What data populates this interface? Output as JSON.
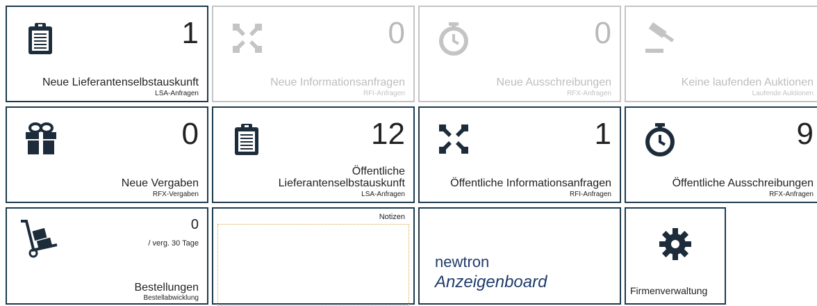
{
  "row1": [
    {
      "count": "1",
      "title": "Neue Lieferantenselbstauskunft",
      "sub": "LSA-Anfragen",
      "icon": "clipboard-icon"
    },
    {
      "count": "0",
      "title": "Neue Informationsanfragen",
      "sub": "RFI-Anfragen",
      "icon": "compress-icon"
    },
    {
      "count": "0",
      "title": "Neue Ausschreibungen",
      "sub": "RFX-Anfragen",
      "icon": "stopwatch-icon"
    },
    {
      "count": "",
      "title": "Keine laufenden Auktionen",
      "sub": "Laufende Auktionen",
      "icon": "gavel-icon"
    }
  ],
  "row2": [
    {
      "count": "0",
      "title": "Neue Vergaben",
      "sub": "RFX-Vergaben",
      "icon": "gift-icon"
    },
    {
      "count": "12",
      "title_line1": "Öffentliche",
      "title_line2": "Lieferantenselbstauskunft",
      "sub": "LSA-Anfragen",
      "icon": "clipboard-icon"
    },
    {
      "count": "1",
      "title": "Öffentliche Informationsanfragen",
      "sub": "RFI-Anfragen",
      "icon": "compress-icon"
    },
    {
      "count": "9",
      "title": "Öffentliche Ausschreibungen",
      "sub": "RFX-Anfragen",
      "icon": "stopwatch-icon"
    }
  ],
  "orders": {
    "count": "0",
    "period": "/ verg. 30 Tage",
    "title": "Bestellungen",
    "sub": "Bestellabwicklung",
    "icon": "hand-truck-icon"
  },
  "notes": {
    "label": "Notizen"
  },
  "newtron": {
    "line1": "newtron",
    "line2": "Anzeigenboard"
  },
  "company": {
    "label": "Firmenverwaltung",
    "icon": "gear-icon"
  },
  "colors": {
    "border": "#1d3a4d",
    "disabled": "#c4c4c4",
    "icon": "#1d2c3a",
    "brand": "#1f3c6b"
  }
}
